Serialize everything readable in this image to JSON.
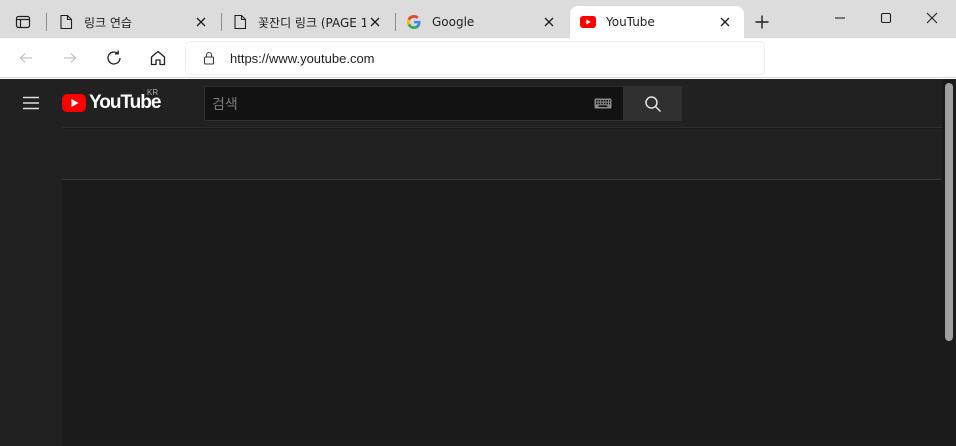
{
  "browser": {
    "tabs": [
      {
        "title": "링크 연습",
        "favicon": "page-icon",
        "active": false
      },
      {
        "title": "꽃잔디 링크 (PAGE 1",
        "favicon": "page-icon",
        "active": false
      },
      {
        "title": "Google",
        "favicon": "google-icon",
        "active": false
      },
      {
        "title": "YouTube",
        "favicon": "youtube-icon",
        "active": true
      }
    ],
    "address": {
      "url": "https://www.youtube.com"
    }
  },
  "youtube": {
    "logo_text": "YouTube",
    "country_code": "KR",
    "search_placeholder": "검색",
    "brand_red": "#ff0000",
    "theme_background": "#1b1b1b"
  }
}
